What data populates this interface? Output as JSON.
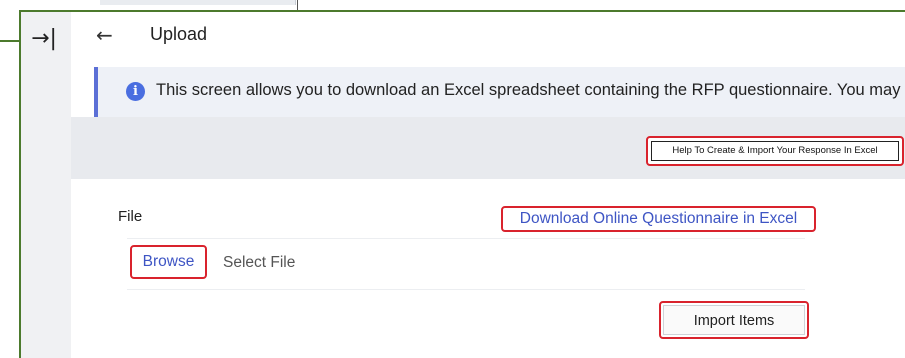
{
  "header": {
    "back_icon": "arrow-left-icon",
    "title": "Upload"
  },
  "rail": {
    "collapse_icon": "arrow-to-right-bar-icon",
    "collapse_glyph": "→|"
  },
  "banner": {
    "icon": "info-icon",
    "icon_glyph": "i",
    "text": "This screen allows you to download an Excel spreadsheet containing the RFP questionnaire. You may"
  },
  "actions": {
    "help_label": "Help To Create & Import Your Response In Excel"
  },
  "form": {
    "file_label": "File",
    "download_link": "Download Online Questionnaire in Excel",
    "browse_label": "Browse",
    "select_file_placeholder": "Select File",
    "import_label": "Import Items"
  },
  "colors": {
    "accent_link": "#3e55c4",
    "banner_border": "#5b6fd6",
    "highlight_red": "#d9232d",
    "panel_border_green": "#4c7a2d"
  }
}
